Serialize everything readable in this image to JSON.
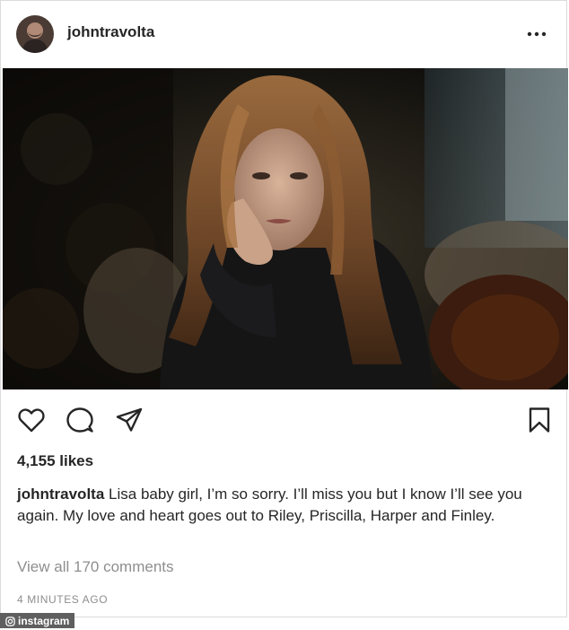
{
  "post": {
    "username": "johntravolta",
    "likes_text": "4,155 likes",
    "caption": {
      "username": "johntravolta",
      "text": "Lisa baby girl, I’m so sorry. I’ll miss you but I know I’ll see you again. My love and heart goes out to Riley, Priscilla, Harper and Finley."
    },
    "view_comments": "View all 170 comments",
    "timestamp": "4 MINUTES AGO"
  },
  "icons": {
    "more": "more-options-icon",
    "like": "heart-icon",
    "comment": "comment-bubble-icon",
    "share": "paper-plane-icon",
    "save": "bookmark-icon"
  },
  "watermark": {
    "text": "instagram"
  },
  "colors": {
    "text": "#262626",
    "muted": "#8e8e8e",
    "border": "#dbdbdb"
  }
}
